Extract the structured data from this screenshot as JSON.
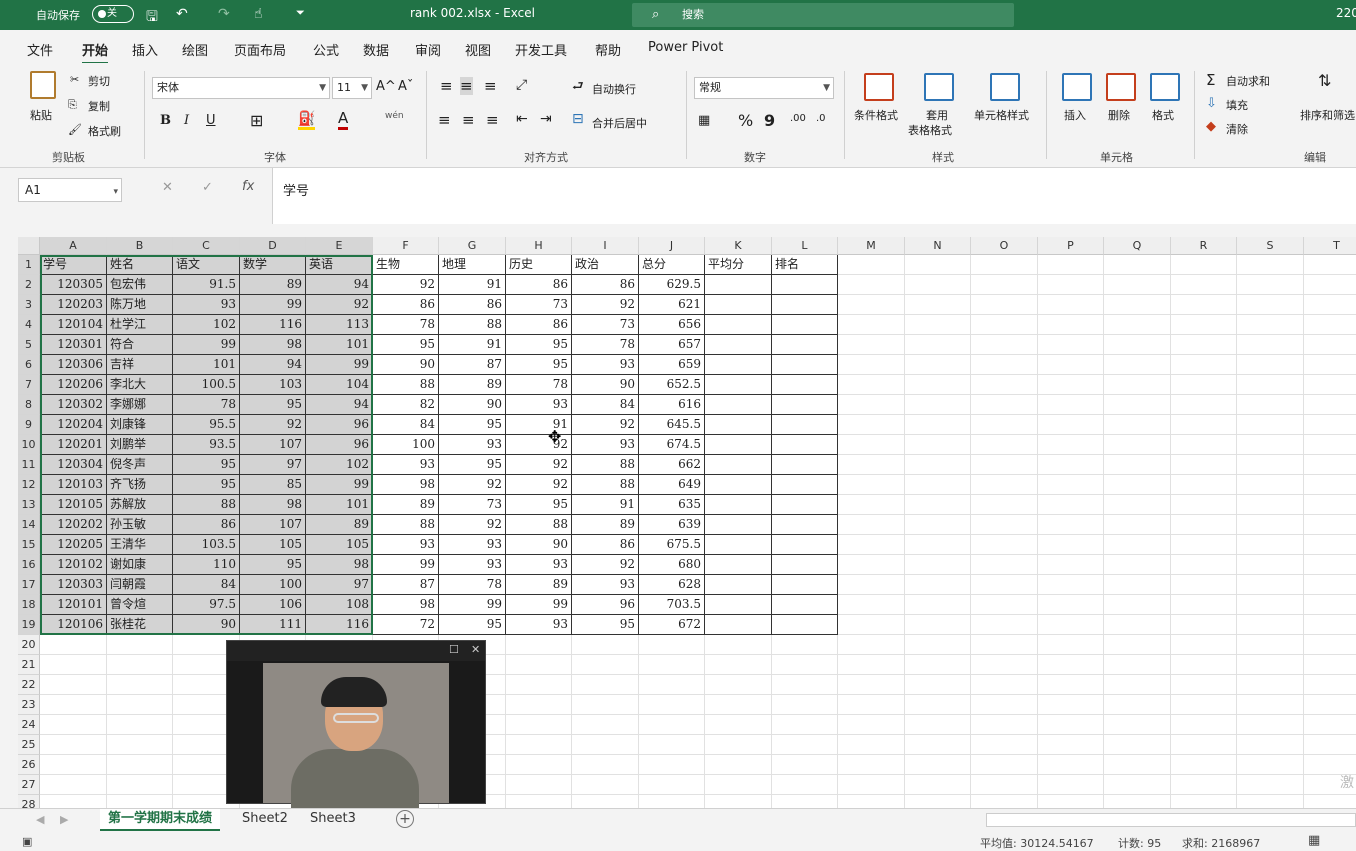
{
  "titlebar": {
    "autosave_label": "自动保存",
    "autosave_state": "关",
    "save_icon": "save-icon",
    "undo_icon": "undo-icon",
    "redo_icon": "redo-icon",
    "touch_icon": "touch-mode-icon",
    "customize_icon": "customize-icon",
    "filename": "rank 002.xlsx  -  Excel",
    "search_placeholder": "搜索",
    "right_text": "220"
  },
  "menu": [
    "文件",
    "开始",
    "插入",
    "绘图",
    "页面布局",
    "公式",
    "数据",
    "审阅",
    "视图",
    "开发工具",
    "帮助",
    "Power Pivot"
  ],
  "menu_active": "开始",
  "ribbon": {
    "clipboard": {
      "paste": "粘贴",
      "cut": "剪切",
      "copy": "复制",
      "format_painter": "格式刷",
      "label": "剪贴板"
    },
    "font": {
      "name": "宋体",
      "size": "11",
      "bold": "B",
      "italic": "I",
      "underline": "U",
      "label": "字体",
      "grow": "A^",
      "shrink": "Aˇ",
      "phonetic": "wén"
    },
    "alignment": {
      "wrap": "自动换行",
      "merge": "合并后居中",
      "label": "对齐方式"
    },
    "number": {
      "format": "常规",
      "percent": "%",
      "comma": "9",
      "label": "数字"
    },
    "styles": {
      "conditional": "条件格式",
      "table_a": "套用",
      "table_b": "表格格式",
      "cell_styles": "单元格样式",
      "label": "样式"
    },
    "cells": {
      "insert": "插入",
      "delete": "删除",
      "format": "格式",
      "label": "单元格"
    },
    "editing": {
      "autosum": "自动求和",
      "fill": "填充",
      "clear": "清除",
      "sort": "排序和筛选",
      "label": "编辑"
    }
  },
  "formula": {
    "namebox": "A1",
    "fx": "fx",
    "content": "学号"
  },
  "columns": [
    "A",
    "B",
    "C",
    "D",
    "E",
    "F",
    "G",
    "H",
    "I",
    "J",
    "K",
    "L",
    "M",
    "N",
    "O",
    "P",
    "Q",
    "R",
    "S",
    "T"
  ],
  "headers": [
    "学号",
    "姓名",
    "语文",
    "数学",
    "英语",
    "生物",
    "地理",
    "历史",
    "政治",
    "总分",
    "平均分",
    "排名"
  ],
  "rows": [
    [
      "120305",
      "包宏伟",
      "91.5",
      "89",
      "94",
      "92",
      "91",
      "86",
      "86",
      "629.5"
    ],
    [
      "120203",
      "陈万地",
      "93",
      "99",
      "92",
      "86",
      "86",
      "73",
      "92",
      "621"
    ],
    [
      "120104",
      "杜学江",
      "102",
      "116",
      "113",
      "78",
      "88",
      "86",
      "73",
      "656"
    ],
    [
      "120301",
      "符合",
      "99",
      "98",
      "101",
      "95",
      "91",
      "95",
      "78",
      "657"
    ],
    [
      "120306",
      "吉祥",
      "101",
      "94",
      "99",
      "90",
      "87",
      "95",
      "93",
      "659"
    ],
    [
      "120206",
      "李北大",
      "100.5",
      "103",
      "104",
      "88",
      "89",
      "78",
      "90",
      "652.5"
    ],
    [
      "120302",
      "李娜娜",
      "78",
      "95",
      "94",
      "82",
      "90",
      "93",
      "84",
      "616"
    ],
    [
      "120204",
      "刘康锋",
      "95.5",
      "92",
      "96",
      "84",
      "95",
      "91",
      "92",
      "645.5"
    ],
    [
      "120201",
      "刘鹏举",
      "93.5",
      "107",
      "96",
      "100",
      "93",
      "92",
      "93",
      "674.5"
    ],
    [
      "120304",
      "倪冬声",
      "95",
      "97",
      "102",
      "93",
      "95",
      "92",
      "88",
      "662"
    ],
    [
      "120103",
      "齐飞扬",
      "95",
      "85",
      "99",
      "98",
      "92",
      "92",
      "88",
      "649"
    ],
    [
      "120105",
      "苏解放",
      "88",
      "98",
      "101",
      "89",
      "73",
      "95",
      "91",
      "635"
    ],
    [
      "120202",
      "孙玉敏",
      "86",
      "107",
      "89",
      "88",
      "92",
      "88",
      "89",
      "639"
    ],
    [
      "120205",
      "王清华",
      "103.5",
      "105",
      "105",
      "93",
      "93",
      "90",
      "86",
      "675.5"
    ],
    [
      "120102",
      "谢如康",
      "110",
      "95",
      "98",
      "99",
      "93",
      "93",
      "92",
      "680"
    ],
    [
      "120303",
      "闫朝霞",
      "84",
      "100",
      "97",
      "87",
      "78",
      "89",
      "93",
      "628"
    ],
    [
      "120101",
      "曾令煊",
      "97.5",
      "106",
      "108",
      "98",
      "99",
      "99",
      "96",
      "703.5"
    ],
    [
      "120106",
      "张桂花",
      "90",
      "111",
      "116",
      "72",
      "95",
      "93",
      "95",
      "672"
    ]
  ],
  "row_numbers": [
    "1",
    "2",
    "3",
    "4",
    "5",
    "6",
    "7",
    "8",
    "9",
    "10",
    "11",
    "12",
    "13",
    "14",
    "15",
    "16",
    "17",
    "18",
    "19",
    "20",
    "21",
    "22",
    "23",
    "24",
    "25",
    "26",
    "27",
    "28"
  ],
  "tabs": [
    "第一学期期末成绩",
    "Sheet2",
    "Sheet3"
  ],
  "add_sheet": "+",
  "status": {
    "average": "平均值: 30124.54167",
    "count": "计数: 95",
    "sum": "求和: 2168967"
  },
  "watermark": "激",
  "colors": {
    "accent": "#217346",
    "selection": "#d3d3d3"
  }
}
